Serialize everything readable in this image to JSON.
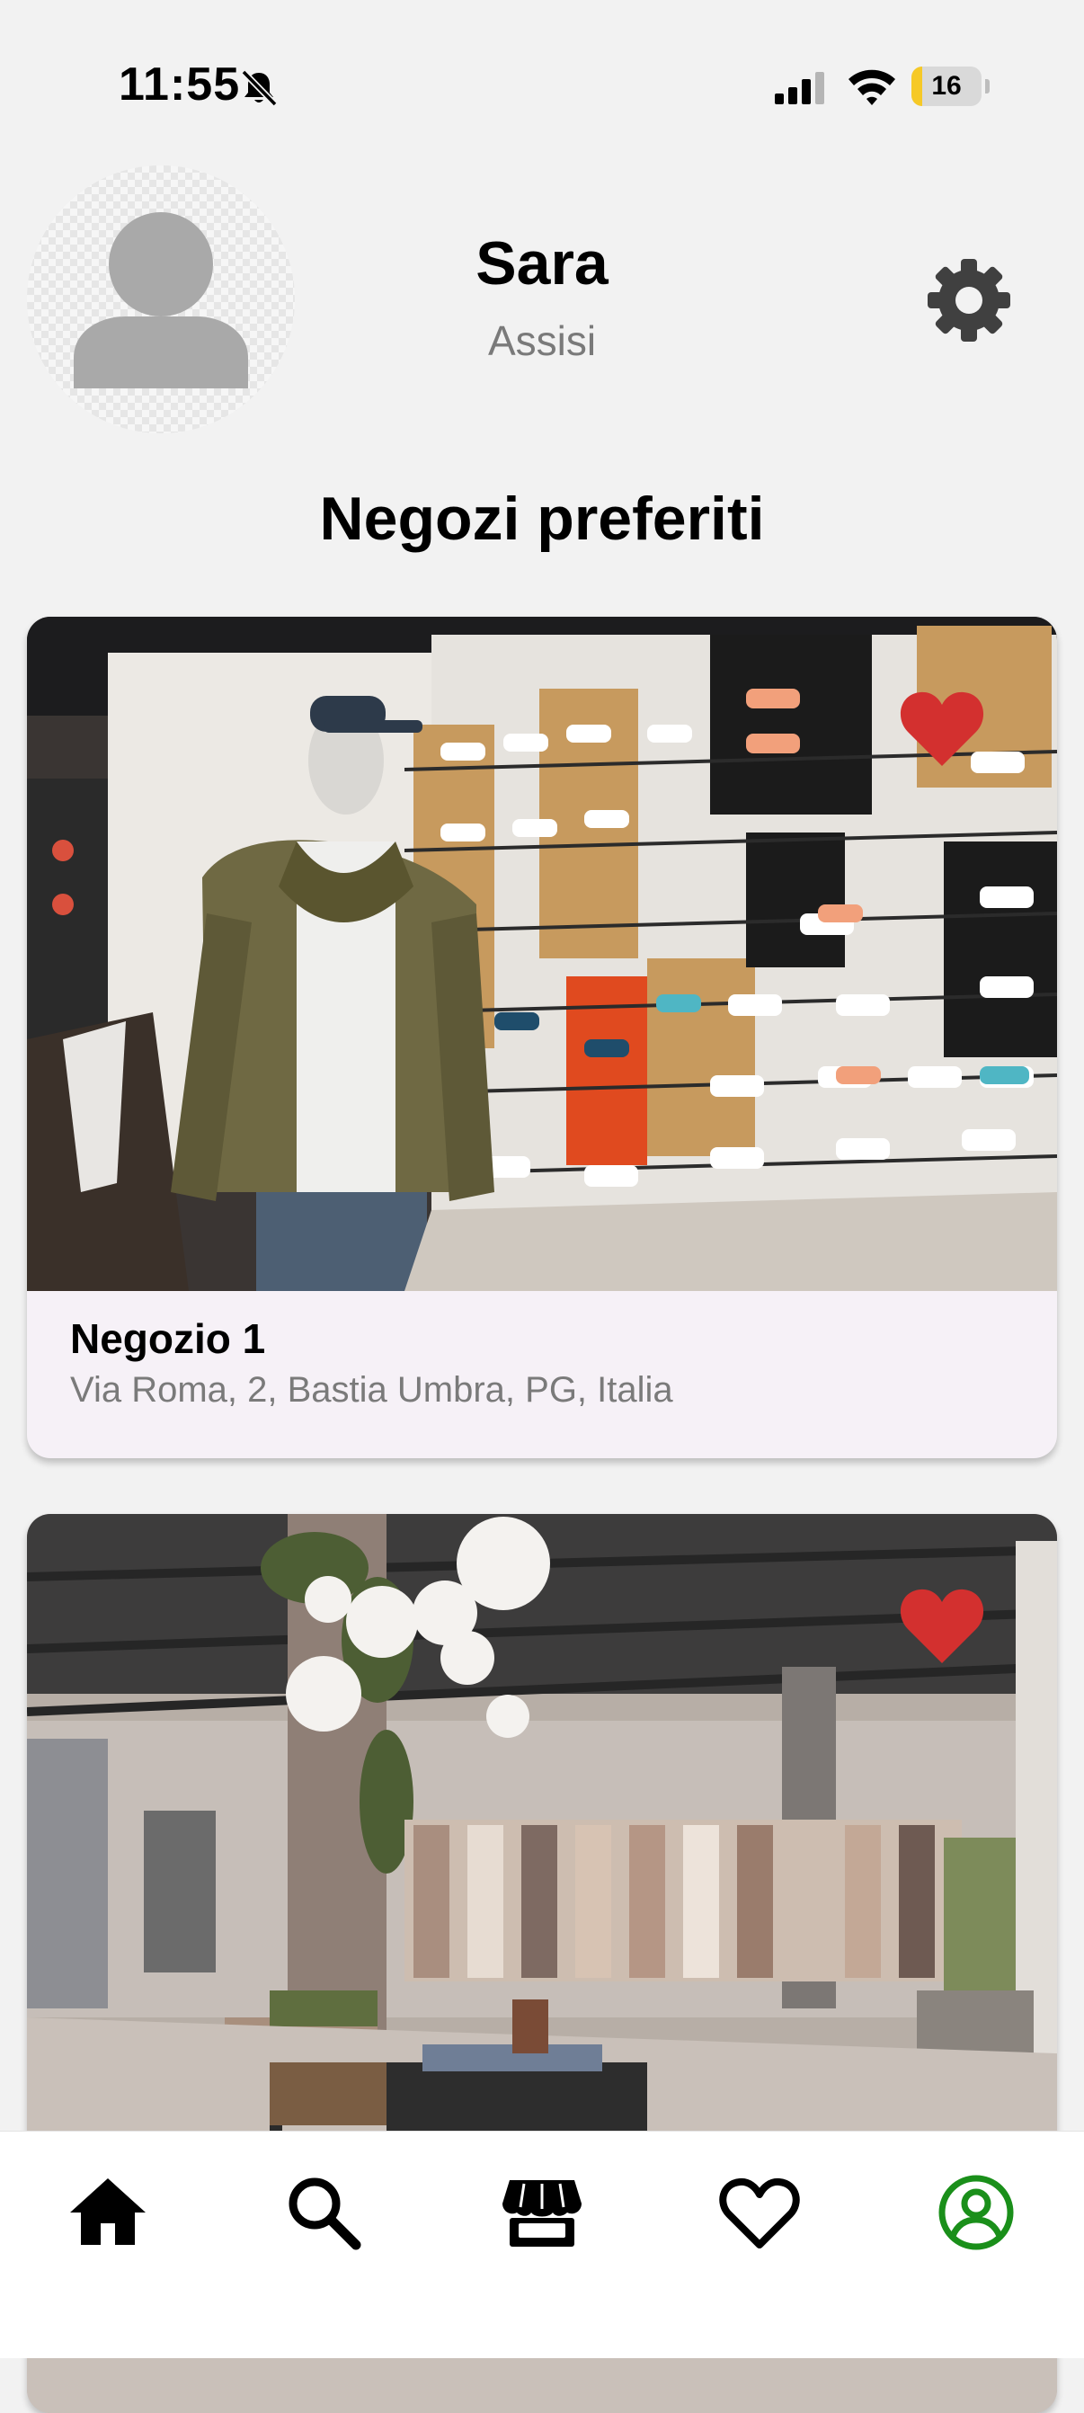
{
  "status_bar": {
    "time": "11:55",
    "battery_level": "16",
    "battery_fraction": 0.16,
    "icons": [
      "bell-off-icon",
      "cellular-signal-icon",
      "wifi-icon",
      "battery-icon"
    ]
  },
  "profile": {
    "name": "Sara",
    "city": "Assisi",
    "settings_icon": "gear-icon"
  },
  "favorites": {
    "title": "Negozi preferiti",
    "stores": [
      {
        "name": "Negozio 1",
        "address": "Via Roma, 2, Bastia Umbra, PG, Italia",
        "image": "sneaker-store-interior",
        "favorited": true
      },
      {
        "name": "",
        "address": "",
        "image": "clothing-store-interior",
        "favorited": true
      }
    ]
  },
  "tab_bar": {
    "tabs": [
      {
        "id": "home",
        "icon": "home-icon",
        "active": false
      },
      {
        "id": "search",
        "icon": "search-icon",
        "active": false
      },
      {
        "id": "stores",
        "icon": "store-icon",
        "active": false
      },
      {
        "id": "favorites",
        "icon": "heart-icon",
        "active": false
      },
      {
        "id": "profile",
        "icon": "account-circle-icon",
        "active": true
      }
    ]
  },
  "colors": {
    "background": "#f2f2f2",
    "card_background": "#f6f1f7",
    "heart": "#d3302f",
    "active_tab": "#1a8f1a",
    "secondary_text": "#7a7a7a",
    "battery": "#f6c927"
  }
}
